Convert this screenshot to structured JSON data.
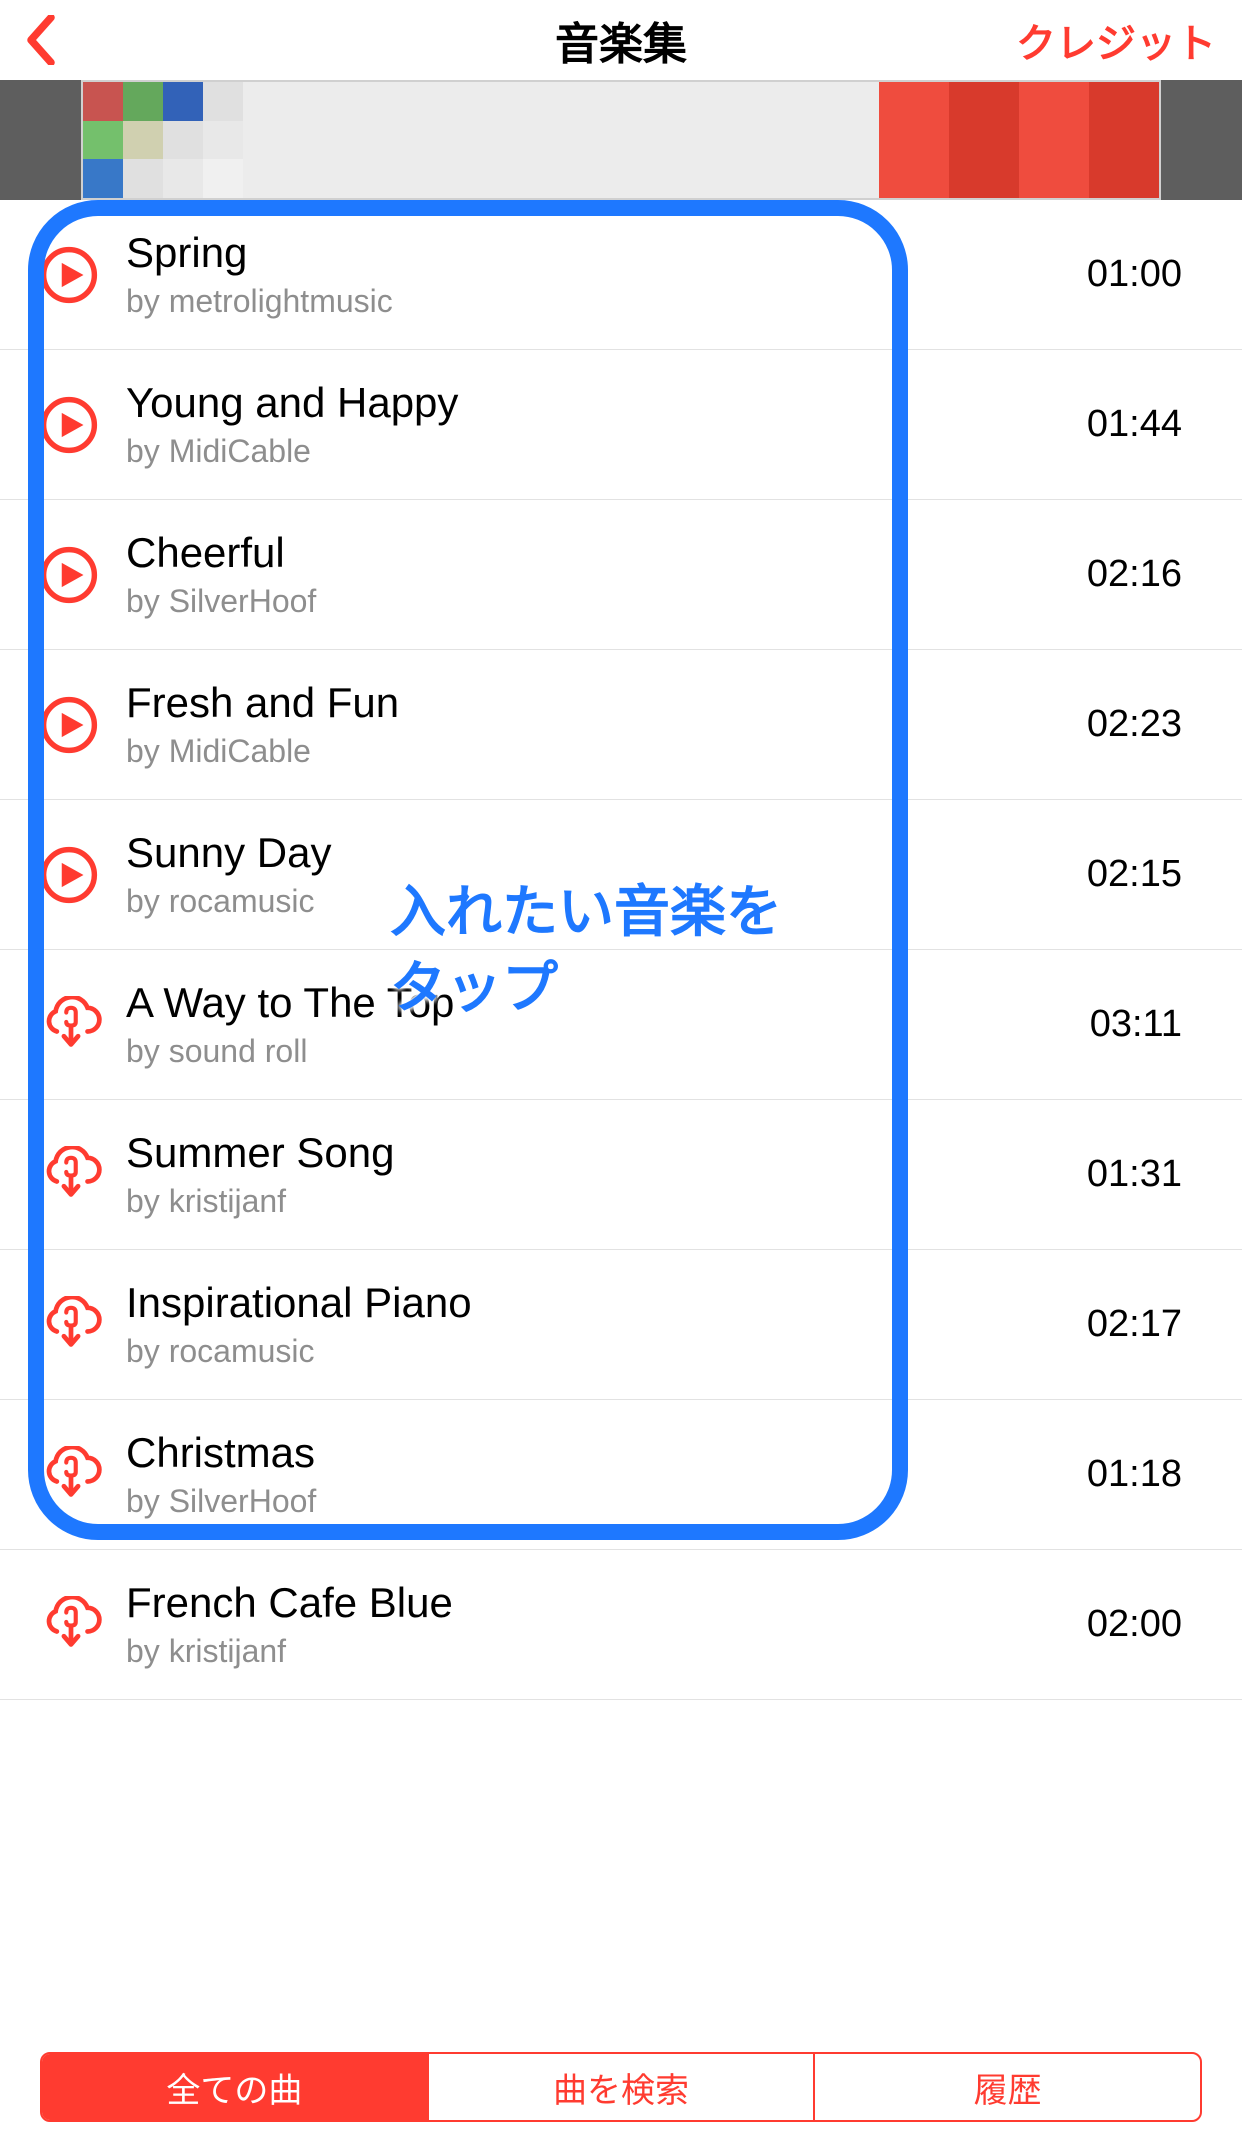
{
  "nav": {
    "title": "音楽集",
    "right": "クレジット"
  },
  "tracks": [
    {
      "title": "Spring",
      "artist": "by metrolightmusic",
      "duration": "01:00",
      "icon": "play"
    },
    {
      "title": "Young and Happy",
      "artist": "by MidiCable",
      "duration": "01:44",
      "icon": "play"
    },
    {
      "title": "Cheerful",
      "artist": "by SilverHoof",
      "duration": "02:16",
      "icon": "play"
    },
    {
      "title": "Fresh and Fun",
      "artist": "by MidiCable",
      "duration": "02:23",
      "icon": "play"
    },
    {
      "title": "Sunny Day",
      "artist": "by rocamusic",
      "duration": "02:15",
      "icon": "play"
    },
    {
      "title": "A Way to The Top",
      "artist": "by sound roll",
      "duration": "03:11",
      "icon": "cloud"
    },
    {
      "title": "Summer Song",
      "artist": "by kristijanf",
      "duration": "01:31",
      "icon": "cloud"
    },
    {
      "title": "Inspirational Piano",
      "artist": "by rocamusic",
      "duration": "02:17",
      "icon": "cloud"
    },
    {
      "title": "Christmas",
      "artist": "by SilverHoof",
      "duration": "01:18",
      "icon": "cloud"
    },
    {
      "title": "French Cafe Blue",
      "artist": "by kristijanf",
      "duration": "02:00",
      "icon": "cloud"
    }
  ],
  "segments": {
    "all": "全ての曲",
    "search": "曲を検索",
    "history": "履歴"
  },
  "annotation": "入れたい音楽を\nタップ"
}
